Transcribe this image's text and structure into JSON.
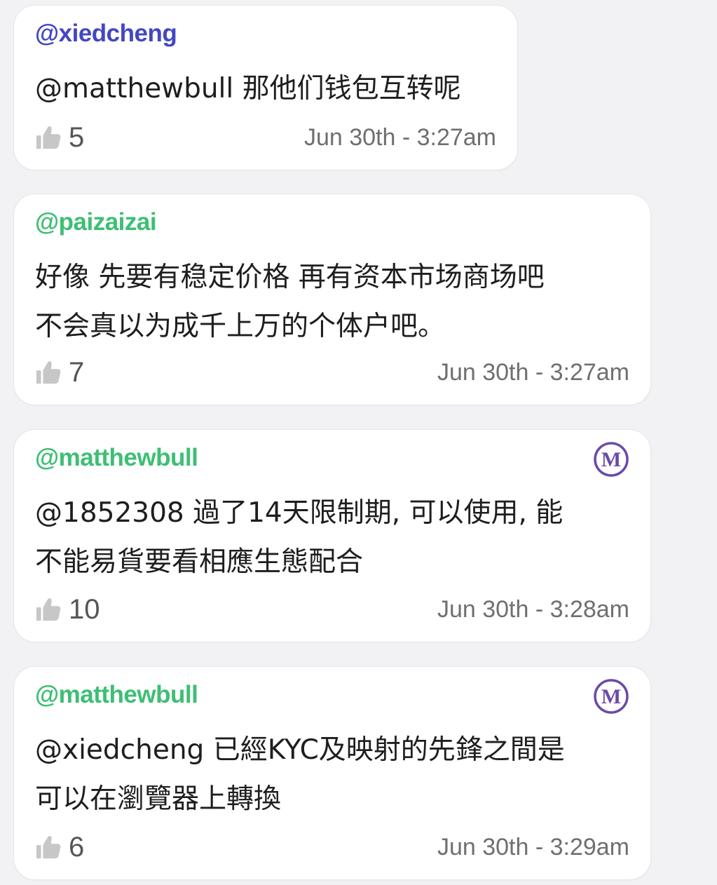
{
  "colors": {
    "username_blue": "#4347c4",
    "username_green": "#3dbf74",
    "moderator_purple": "#6b4aa8",
    "thumb_gray": "#c7c7c7"
  },
  "comments": [
    {
      "username": "@xiedcheng",
      "username_color": "#4347c4",
      "text": "@matthewbull 那他们钱包互转呢",
      "likes": "5",
      "time": "Jun 30th - 3:27am",
      "moderator_badge": false
    },
    {
      "username": "@paizaizai",
      "username_color": "#3dbf74",
      "text": "好像 先要有稳定价格 再有资本市场商场吧\n不会真以为成千上万的个体户吧。",
      "likes": "7",
      "time": "Jun 30th - 3:27am",
      "moderator_badge": false
    },
    {
      "username": "@matthewbull",
      "username_color": "#3dbf74",
      "text": "@1852308 過了14天限制期, 可以使用, 能\n不能易貨要看相應生態配合",
      "likes": "10",
      "time": "Jun 30th - 3:28am",
      "moderator_badge": true,
      "badge_letter": "M"
    },
    {
      "username": "@matthewbull",
      "username_color": "#3dbf74",
      "text": "@xiedcheng 已經KYC及映射的先鋒之間是\n可以在瀏覽器上轉換",
      "likes": "6",
      "time": "Jun 30th - 3:29am",
      "moderator_badge": true,
      "badge_letter": "M"
    }
  ],
  "icons": {
    "like": "thumbs-up-icon",
    "moderator": "moderator-m-badge-icon"
  }
}
